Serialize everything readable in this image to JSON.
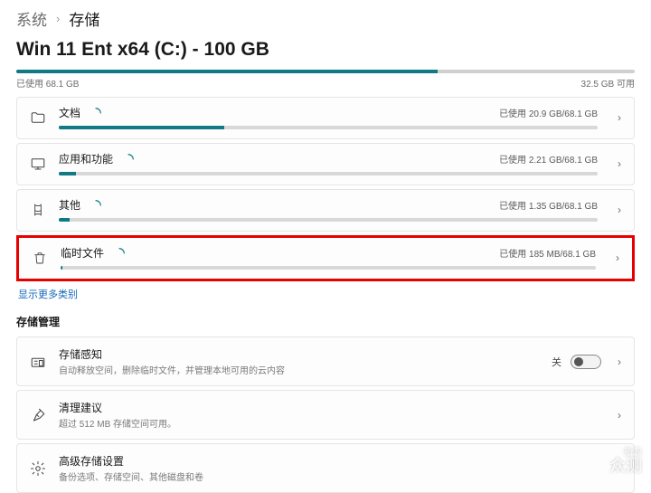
{
  "breadcrumb": {
    "parent": "系统",
    "current": "存储"
  },
  "drive": {
    "title": "Win 11 Ent x64 (C:) - 100 GB",
    "used_pct": 68.1,
    "used_label": "已使用 68.1 GB",
    "free_label": "32.5 GB 可用"
  },
  "categories": [
    {
      "icon": "folder",
      "title": "文档",
      "loading": true,
      "usage": "已使用 20.9 GB/68.1 GB",
      "pct": 30.7
    },
    {
      "icon": "apps",
      "title": "应用和功能",
      "loading": true,
      "usage": "已使用 2.21 GB/68.1 GB",
      "pct": 3.2
    },
    {
      "icon": "other",
      "title": "其他",
      "loading": true,
      "usage": "已使用 1.35 GB/68.1 GB",
      "pct": 2.0
    },
    {
      "icon": "trash",
      "title": "临时文件",
      "loading": true,
      "usage": "已使用 185 MB/68.1 GB",
      "pct": 0.3,
      "highlight": true
    }
  ],
  "show_more": "显示更多类别",
  "mgmt_section": "存储管理",
  "mgmt": [
    {
      "icon": "sense",
      "title": "存储感知",
      "desc": "自动释放空间，删除临时文件，并管理本地可用的云内容",
      "toggle": {
        "label": "关",
        "on": false
      },
      "chevron": true
    },
    {
      "icon": "broom",
      "title": "清理建议",
      "desc": "超过 512 MB 存储空间可用。",
      "chevron": true
    },
    {
      "icon": "gear",
      "title": "高级存储设置",
      "desc": "备份选项、存储空间、其他磁盘和卷",
      "chevron": false
    }
  ],
  "watermark": {
    "line1": "新浪",
    "line2": "众测"
  }
}
